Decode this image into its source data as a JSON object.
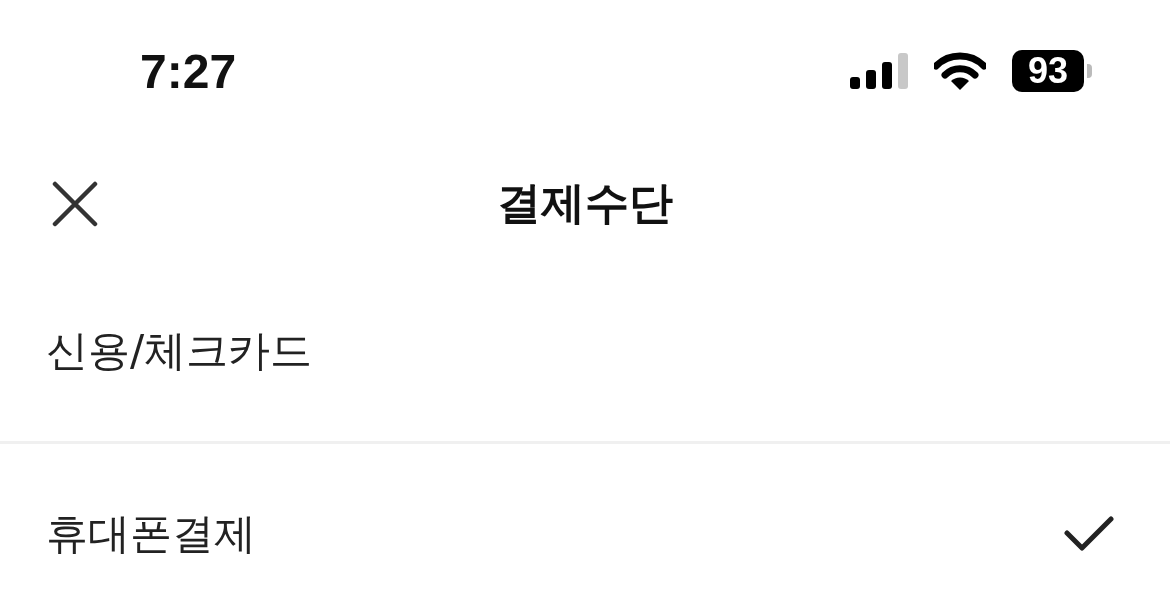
{
  "status_bar": {
    "time": "7:27",
    "battery": "93"
  },
  "header": {
    "title": "결제수단"
  },
  "methods": [
    {
      "label": "신용/체크카드",
      "selected": false
    },
    {
      "label": "휴대폰결제",
      "selected": true
    }
  ]
}
